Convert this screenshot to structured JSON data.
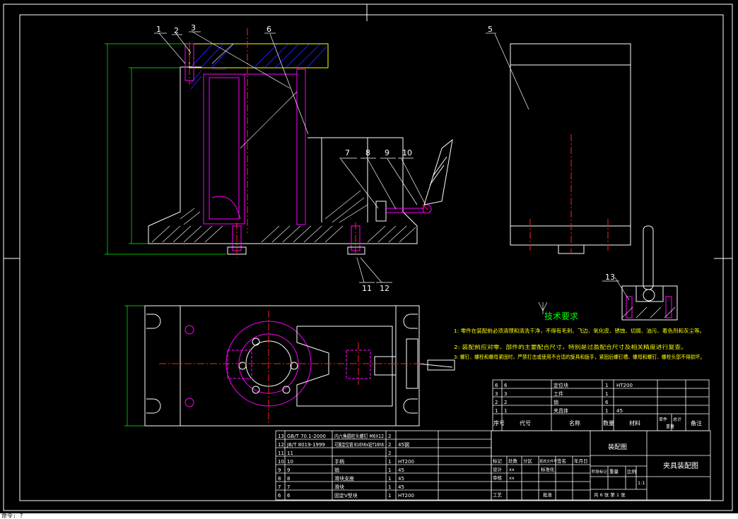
{
  "colors": {
    "background": "#000000",
    "frame": "#ffffff",
    "outline": "#ffffff",
    "magenta": "#ff00ff",
    "red": "#ff2020",
    "green": "#00ff00",
    "yellow": "#ffff00",
    "cyan": "#00ffff"
  },
  "balloons": [
    "1",
    "2",
    "3",
    "6",
    "5",
    "7",
    "8",
    "9",
    "10",
    "11",
    "12",
    "13"
  ],
  "tech_requirements": {
    "title": "技术要求",
    "lines": [
      "1: 零件在装配前必须清理和清洗干净，不得有毛刺、飞边、氧化皮、锈蚀、切屑、油污、着色剂和灰尘等。",
      "2: 装配前应对零、部件的主要配合尺寸，特别是过盈配合尺寸及相关精度进行复查。",
      "3: 螺钉、螺栓和螺母紧固时，严禁打击或使用不合适的旋具和扳手，紧固后螺钉槽、螺母和螺钉、螺栓头部不得损坏。"
    ]
  },
  "small_bom": {
    "rows": [
      {
        "no": "6",
        "code": "6",
        "name": "定位块",
        "qty": "1",
        "material": "HT200"
      },
      {
        "no": "3",
        "code": "3",
        "name": "工件",
        "qty": "1",
        "material": ""
      },
      {
        "no": "2",
        "code": "2",
        "name": "销",
        "qty": "6",
        "material": ""
      },
      {
        "no": "1",
        "code": "1",
        "name": "夹具体",
        "qty": "1",
        "material": "45"
      }
    ],
    "header": {
      "no": "序号",
      "code": "代号",
      "name": "名称",
      "qty": "数量",
      "material": "材料",
      "single": "单件",
      "total": "总计",
      "weight": "重量",
      "remark": "备注"
    }
  },
  "main_bom": {
    "rows": [
      {
        "no": "13",
        "code": "GB/T 70.1-2000",
        "name": "内六角圆柱头螺钉 M6X12",
        "qty": "2",
        "material": ""
      },
      {
        "no": "12",
        "code": "JB/T 8019-1999",
        "name": "可换定位销 B16h6x钻T16h6",
        "qty": "2",
        "material": "45钢"
      },
      {
        "no": "11",
        "code": "11",
        "name": "",
        "qty": "2",
        "material": ""
      },
      {
        "no": "10",
        "code": "10",
        "name": "手柄",
        "qty": "1",
        "material": "HT200"
      },
      {
        "no": "9",
        "code": "9",
        "name": "销",
        "qty": "1",
        "material": "45"
      },
      {
        "no": "8",
        "code": "8",
        "name": "滑块支座",
        "qty": "1",
        "material": "45"
      },
      {
        "no": "7",
        "code": "7",
        "name": "滑块",
        "qty": "1",
        "material": "45"
      },
      {
        "no": "6",
        "code": "6",
        "name": "固定V型块",
        "qty": "1",
        "material": "HT200"
      }
    ]
  },
  "title_block": {
    "drawing_name": "装配图",
    "title": "夹具装配图",
    "sign_labels": [
      "标记",
      "处数",
      "分区",
      "更改文件号",
      "签名",
      "年月日"
    ],
    "role_labels": [
      "设计",
      "审核",
      "工艺"
    ],
    "designer_value": "xx",
    "reviewer_value": "xx",
    "std_label": "标准化",
    "approve_label": "批准",
    "stage_labels": [
      "阶段标记",
      "重量",
      "比例"
    ],
    "scale": "1:1",
    "sheets": "共 6 张  第 1 张"
  },
  "command_line": "命令: ?"
}
